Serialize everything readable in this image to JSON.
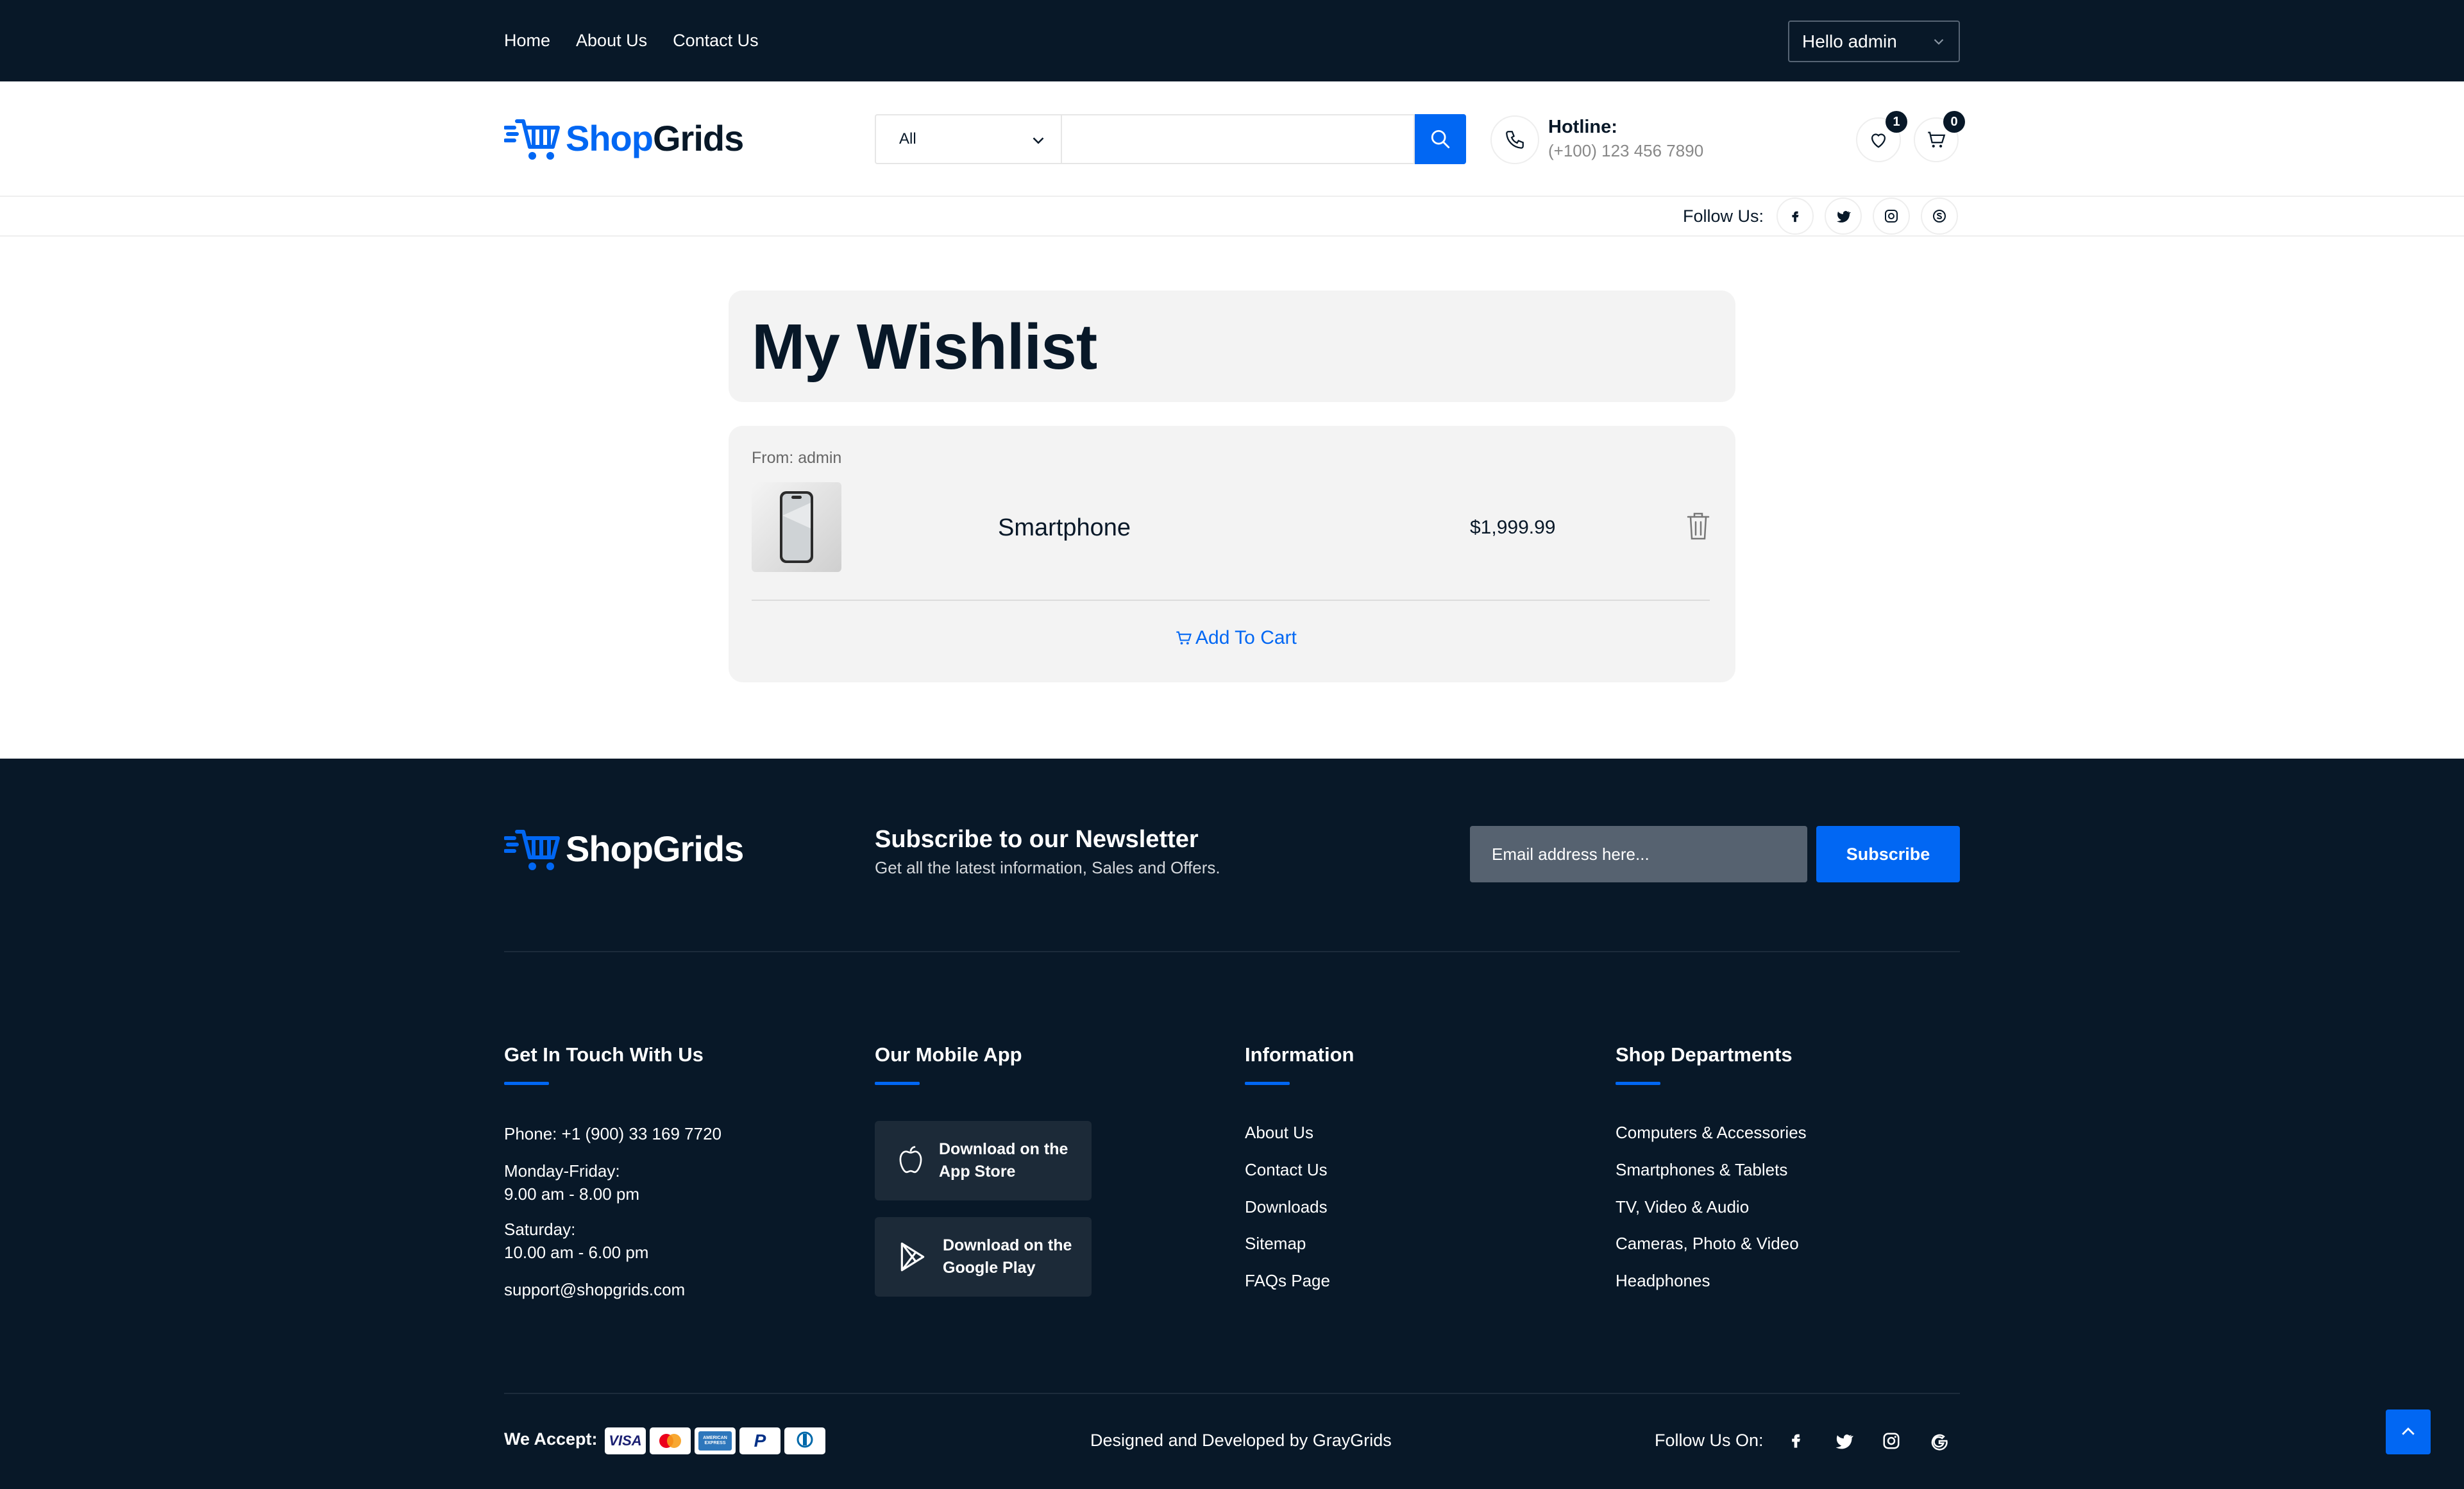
{
  "topbar": {
    "nav": [
      "Home",
      "About Us",
      "Contact Us"
    ],
    "user_greeting": "Hello admin"
  },
  "header": {
    "brand_part1": "Shop",
    "brand_part2": "Grids",
    "category_selected": "All",
    "search_placeholder": "",
    "hotline_label": "Hotline:",
    "hotline_number": "(+100) 123 456 7890",
    "wishlist_count": "1",
    "cart_count": "0",
    "follow_label": "Follow Us:"
  },
  "wishlist": {
    "title": "My Wishlist",
    "from": "From: admin",
    "item": {
      "name": "Smartphone",
      "price": "$1,999.99"
    },
    "add_to_cart": "Add To Cart"
  },
  "footer": {
    "brand": "ShopGrids",
    "newsletter_title": "Subscribe to our Newsletter",
    "newsletter_sub": "Get all the latest information, Sales and Offers.",
    "email_placeholder": "Email address here...",
    "subscribe_label": "Subscribe",
    "contact": {
      "title": "Get In Touch With Us",
      "phone": "Phone: +1 (900) 33 169 7720",
      "weekday_label": "Monday-Friday:",
      "weekday_hours": "9.00 am - 8.00 pm",
      "saturday_label": "Saturday:",
      "saturday_hours": "10.00 am - 6.00 pm",
      "email": "support@shopgrids.com"
    },
    "mobile_app": {
      "title": "Our Mobile App",
      "app_store_line1": "Download on the",
      "app_store_line2": "App Store",
      "google_play_line1": "Download on the",
      "google_play_line2": "Google Play"
    },
    "information": {
      "title": "Information",
      "links": [
        "About Us",
        "Contact Us",
        "Downloads",
        "Sitemap",
        "FAQs Page"
      ]
    },
    "departments": {
      "title": "Shop Departments",
      "links": [
        "Computers & Accessories",
        "Smartphones & Tablets",
        "TV, Video & Audio",
        "Cameras, Photo & Video",
        "Headphones"
      ]
    },
    "we_accept": "We Accept:",
    "payment_cards": [
      "VISA",
      "Mastercard",
      "American Express",
      "PayPal",
      "Diners Club"
    ],
    "credit": "Designed and Developed by GrayGrids",
    "follow_on": "Follow Us On:"
  },
  "colors": {
    "dark": "#081828",
    "accent": "#0167f3",
    "card_bg": "#f3f3f3"
  }
}
